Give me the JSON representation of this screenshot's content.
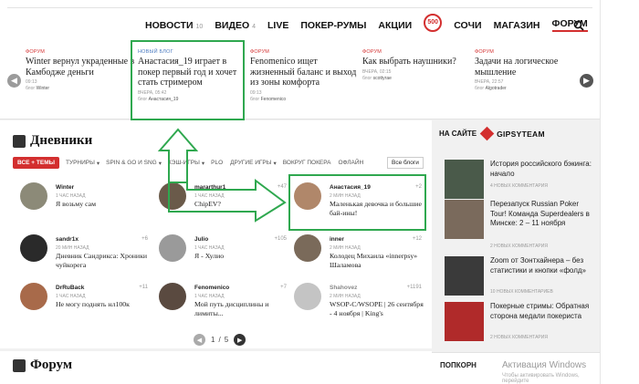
{
  "nav": {
    "items": [
      {
        "label": "НОВОСТИ",
        "count": "10"
      },
      {
        "label": "ВИДЕО",
        "count": "4"
      },
      {
        "label": "LIVE",
        "count": ""
      },
      {
        "label": "ПОКЕР-РУМЫ",
        "count": ""
      },
      {
        "label": "АКЦИИ",
        "count": ""
      },
      {
        "label": "СОЧИ",
        "count": ""
      },
      {
        "label": "МАГАЗИН",
        "count": ""
      },
      {
        "label": "ФОРУМ",
        "count": ""
      }
    ],
    "logo_text": "500"
  },
  "news": [
    {
      "tag": "ФОРУМ",
      "title": "Winter вернул украденные в Камбодже деньги",
      "time": "09:13",
      "blog_label": "блог",
      "author": "Winter"
    },
    {
      "tag": "НОВЫЙ БЛОГ",
      "title": "Анастасия_19 играет в покер первый год и хочет стать стримером",
      "time": "ВЧЕРА, 05:42",
      "blog_label": "блог",
      "author": "Анастасия_19"
    },
    {
      "tag": "ФОРУМ",
      "title": "Fenomenico ищет жизненный баланс и выход из зоны комфорта",
      "time": "09:13",
      "blog_label": "блог",
      "author": "Fenomenico"
    },
    {
      "tag": "ФОРУМ",
      "title": "Как выбрать наушники?",
      "time": "ВЧЕРА, 02:15",
      "blog_label": "блог",
      "author": "scottyrae"
    },
    {
      "tag": "ФОРУМ",
      "title": "Задачи на логическое мышление",
      "time": "ВЧЕРА, 22:57",
      "blog_label": "блог",
      "author": "Algotrader"
    }
  ],
  "diaries": {
    "title": "Дневники",
    "filters": [
      "ВСЕ + ТЕМЫ",
      "ТУРНИРЫ",
      "SPIN & GO И SNG",
      "КЭШ-ИГРЫ",
      "PLO",
      "ДРУГИЕ ИГРЫ",
      "ВОКРУГ ПОКЕРА",
      "ОФЛАЙН"
    ],
    "all_blogs": "Все блоги",
    "posts": [
      {
        "name": "Winter",
        "count": "",
        "time": "1 ЧАС НАЗАД",
        "text": "Я возьму сам"
      },
      {
        "name": "mararthur1",
        "count": "+47",
        "time": "1 ЧАС НАЗАД",
        "text": "ChipEV?"
      },
      {
        "name": "Анастасия_19",
        "count": "+2",
        "time": "2 МИН НАЗАД",
        "text": "Маленькая девочка и большие бай-ины!"
      },
      {
        "name": "sandr1x",
        "count": "+6",
        "time": "20 МИН НАЗАД",
        "text": "Дневник Сандрикса: Хроники чуйкорега"
      },
      {
        "name": "Julio",
        "count": "+105",
        "time": "1 ЧАС НАЗАД",
        "text": "Я - Хулио"
      },
      {
        "name": "inner",
        "count": "+12",
        "time": "2 МИН НАЗАД",
        "text": "Колодец Михаила «innerpsy» Шаламова"
      },
      {
        "name": "DrRuBack",
        "count": "+11",
        "time": "1 ЧАС НАЗАД",
        "text": "Не могу поднять нл100к"
      },
      {
        "name": "Fenomenico",
        "count": "+7",
        "time": "1 ЧАС НАЗАД",
        "text": "Мой путь дисциплины и лимиты..."
      },
      {
        "name": "Shahovez",
        "count": "+1191",
        "time": "2 МИН НАЗАД",
        "text": "WSOP-C/WSOPE | 26 сентября - 4 ноября | King's"
      }
    ],
    "pager": {
      "current": "1",
      "sep": "/",
      "total": "5"
    }
  },
  "forum": {
    "title": "Форум"
  },
  "sidebar": {
    "heading": "НА САЙТЕ",
    "brand": "GIPSYTEAM",
    "items": [
      {
        "title": "История российского бэкинга: начало",
        "comments": "4 НОВЫХ КОММЕНТАРИЯ"
      },
      {
        "title": "Перезапуск Russian Poker Tour! Команда Superdealers в Минске: 2 – 11 ноября",
        "comments": "2 НОВЫХ КОММЕНТАРИЯ"
      },
      {
        "title": "Zoom от Зонтхайнера – без статистики и кнопки «фолд»",
        "comments": "10 НОВЫХ КОММЕНТАРИЕВ"
      },
      {
        "title": "Покерные стримы: Обратная сторона медали покериста",
        "comments": "2 НОВЫХ КОММЕНТАРИЯ"
      }
    ],
    "popkorn": "ПОПКОРН"
  },
  "watermark": {
    "line1": "Активация Windows",
    "line2": "Чтобы активировать Windows, перейдите"
  }
}
